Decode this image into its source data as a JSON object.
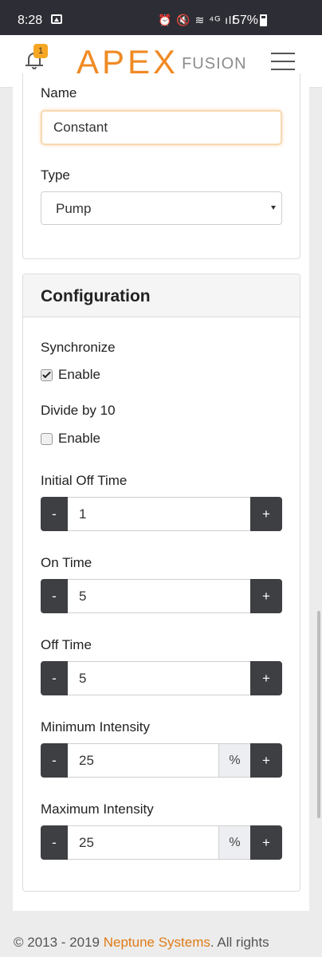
{
  "status_bar": {
    "time": "8:28",
    "icons_text": "⏰ 🔇 ≋ ⁴ᴳ ıll",
    "battery": "57%"
  },
  "header": {
    "notification_count": "1",
    "logo_primary": "APEX",
    "logo_secondary": "FUSION"
  },
  "form": {
    "name_label": "Name",
    "name_value": "Constant",
    "type_label": "Type",
    "type_value": "Pump"
  },
  "configuration": {
    "title": "Configuration",
    "synchronize_label": "Synchronize",
    "synchronize_option": "Enable",
    "synchronize_checked": true,
    "divide_label": "Divide by 10",
    "divide_option": "Enable",
    "divide_checked": false,
    "minus": "-",
    "plus": "+",
    "fields": [
      {
        "label": "Initial Off Time",
        "value": "1"
      },
      {
        "label": "On Time",
        "value": "5"
      },
      {
        "label": "Off Time",
        "value": "5"
      },
      {
        "label": "Minimum Intensity",
        "value": "25",
        "unit": "%"
      },
      {
        "label": "Maximum Intensity",
        "value": "25",
        "unit": "%"
      }
    ]
  },
  "footer": {
    "prefix": "© 2013 - 2019 ",
    "company": "Neptune Systems",
    "suffix": ". All rights"
  },
  "colors": {
    "brand_orange": "#f08a24",
    "button_dark": "#3d3f42",
    "status_bar": "#2d2d35"
  }
}
